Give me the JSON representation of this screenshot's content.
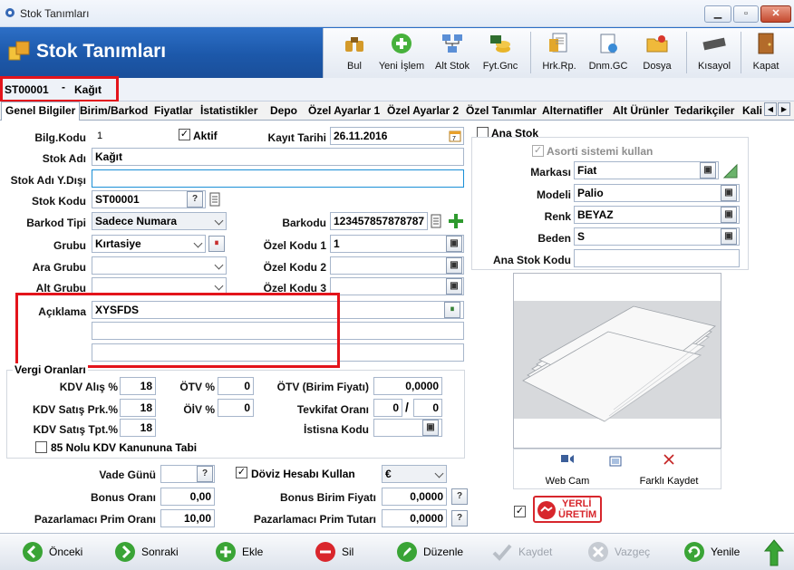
{
  "window": {
    "title": "Stok Tanımları"
  },
  "header": {
    "title": "Stok Tanımları"
  },
  "toolbar": [
    {
      "label": "Bul",
      "icon": "binoculars-icon"
    },
    {
      "label": "Yeni İşlem",
      "icon": "add-icon"
    },
    {
      "label": "Alt Stok",
      "icon": "network-icon"
    },
    {
      "label": "Fyt.Gnc",
      "icon": "coins-icon"
    },
    {
      "label": "Hrk.Rp.",
      "icon": "report-icon"
    },
    {
      "label": "Dnm.GC",
      "icon": "clipboard-icon"
    },
    {
      "label": "Dosya",
      "icon": "folder-icon"
    },
    {
      "label": "Kısayol",
      "icon": "keyboard-icon"
    },
    {
      "label": "Kapat",
      "icon": "door-icon"
    }
  ],
  "code_strip": {
    "code": "ST00001",
    "separator": "-",
    "name": "Kağıt"
  },
  "tabs": [
    "Genel Bilgiler",
    "Birim/Barkod",
    "Fiyatlar",
    "İstatistikler",
    "Depo",
    "Özel Ayarlar 1",
    "Özel Ayarlar 2",
    "Özel Tanımlar",
    "Alternatifler",
    "Alt Ürünler",
    "Tedarikçiler",
    "Kali"
  ],
  "form": {
    "bilg_kodu_label": "Bilg.Kodu",
    "bilg_kodu_value": "1",
    "aktif_label": "Aktif",
    "kayit_tarihi_label": "Kayıt Tarihi",
    "kayit_tarihi_value": "26.11.2016",
    "stok_adi_label": "Stok Adı",
    "stok_adi_value": "Kağıt",
    "stok_adi_yd_label": "Stok Adı Y.Dışı",
    "stok_adi_yd_value": "",
    "stok_kodu_label": "Stok Kodu",
    "stok_kodu_value": "ST00001",
    "barkod_tipi_label": "Barkod Tipi",
    "barkod_tipi_value": "Sadece Numara",
    "barkodu_label": "Barkodu",
    "barkodu_value": "123457857878787",
    "grubu_label": "Grubu",
    "grubu_value": "Kırtasiye",
    "ozel_kodu1_label": "Özel Kodu 1",
    "ozel_kodu1_value": "1",
    "ara_grubu_label": "Ara Grubu",
    "ara_grubu_value": "",
    "ozel_kodu2_label": "Özel Kodu 2",
    "ozel_kodu2_value": "",
    "alt_grubu_label": "Alt Grubu",
    "alt_grubu_value": "",
    "ozel_kodu3_label": "Özel Kodu 3",
    "ozel_kodu3_value": "",
    "aciklama_label": "Açıklama",
    "aciklama_value": "XYSFDS",
    "aciklama2_value": "",
    "aciklama3_value": ""
  },
  "vergi": {
    "title": "Vergi Oranları",
    "kdv_alis_label": "KDV Alış %",
    "kdv_alis_value": "18",
    "otv_label": "ÖTV %",
    "otv_value": "0",
    "otv_birim_label": "ÖTV (Birim Fiyatı)",
    "otv_birim_value": "0,0000",
    "kdv_satis_prk_label": "KDV Satış Prk.%",
    "kdv_satis_prk_value": "18",
    "oiv_label": "ÖİV %",
    "oiv_value": "0",
    "tevkifat_label": "Tevkifat Oranı",
    "tevkifat_value1": "0",
    "tevkifat_sep": "/",
    "tevkifat_value2": "0",
    "kdv_satis_tpt_label": "KDV Satış Tpt.%",
    "kdv_satis_tpt_value": "18",
    "istisna_label": "İstisna Kodu",
    "istisna_value": "",
    "kanun_label": "85 Nolu KDV Kanununa Tabi"
  },
  "bottom_form": {
    "vade_label": "Vade Günü",
    "vade_value": "",
    "doviz_label": "Döviz Hesabı Kullan",
    "doviz_value": "€",
    "bonus_orani_label": "Bonus Oranı",
    "bonus_orani_value": "0,00",
    "bonus_birim_label": "Bonus Birim Fiyatı",
    "bonus_birim_value": "0,0000",
    "pazarlamaci_orani_label": "Pazarlamacı Prim Oranı",
    "pazarlamaci_orani_value": "10,00",
    "pazarlamaci_tutari_label": "Pazarlamacı Prim Tutarı",
    "pazarlamaci_tutari_value": "0,0000"
  },
  "right_panel": {
    "ana_stok_label": "Ana Stok",
    "asorti_label": "Asorti sistemi kullan",
    "markasi_label": "Markası",
    "markasi_value": "Fiat",
    "modeli_label": "Modeli",
    "modeli_value": "Palio",
    "renk_label": "Renk",
    "renk_value": "BEYAZ",
    "beden_label": "Beden",
    "beden_value": "S",
    "ana_stok_kodu_label": "Ana Stok Kodu",
    "ana_stok_kodu_value": "",
    "web_cam_label": "Web Cam",
    "farkli_kaydet_label": "Farklı Kaydet",
    "badge_line1": "YERLİ",
    "badge_line2": "ÜRETİM"
  },
  "bottom_bar": [
    {
      "label": "Önceki",
      "color": "#3aa436"
    },
    {
      "label": "Sonraki",
      "color": "#3aa436"
    },
    {
      "label": "Ekle",
      "color": "#3aa436"
    },
    {
      "label": "Sil",
      "color": "#d9262c"
    },
    {
      "label": "Düzenle",
      "color": "#3aa436"
    },
    {
      "label": "Kaydet",
      "color": "#b8bec6"
    },
    {
      "label": "Vazgeç",
      "color": "#b8bec6"
    },
    {
      "label": "Yenile",
      "color": "#3aa436"
    }
  ],
  "colors": {
    "header": "#1f5cae",
    "highlight": "#e3141b",
    "accent_green": "#3aa436"
  }
}
